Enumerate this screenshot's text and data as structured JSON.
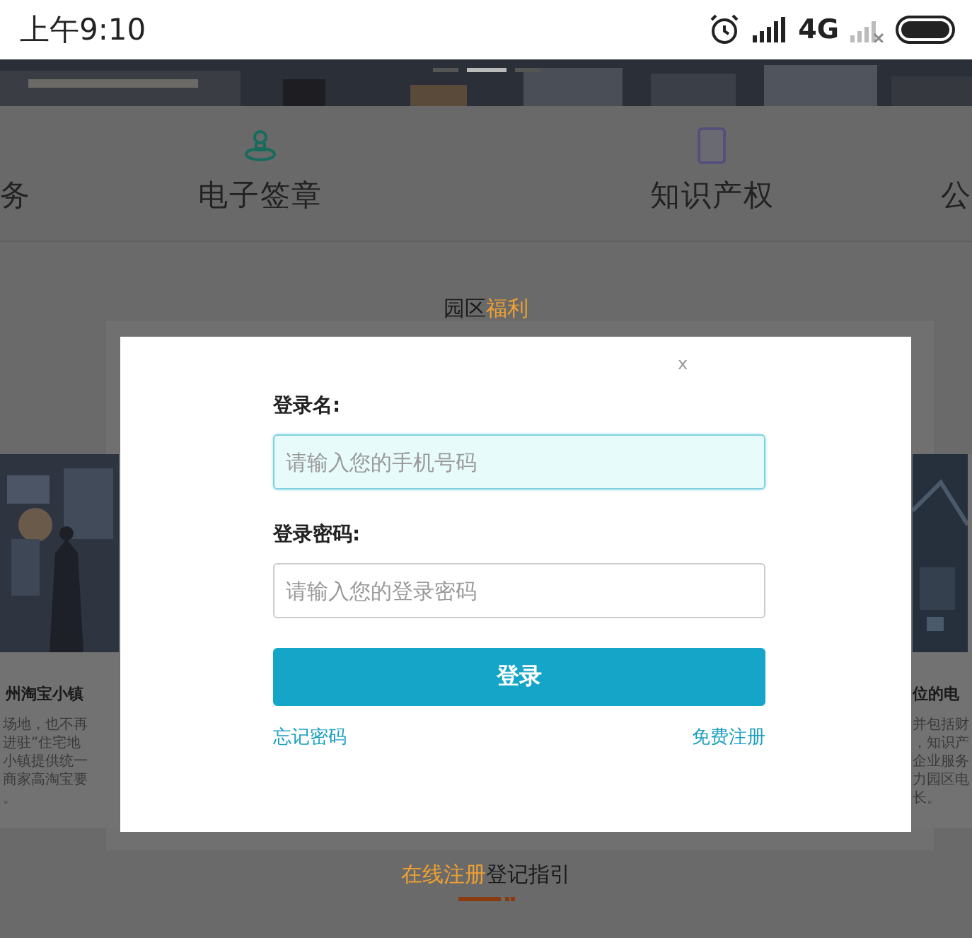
{
  "status_bar": {
    "time": "上午9:10",
    "network": "4G"
  },
  "banner": {
    "slides": [
      {
        "selected": false
      },
      {
        "selected": true
      },
      {
        "selected": false
      }
    ]
  },
  "nav": {
    "items": [
      {
        "label": "务"
      },
      {
        "label": "电子签章"
      },
      {
        "label": "知识产权"
      },
      {
        "label": "公"
      }
    ]
  },
  "section": {
    "title": "园区",
    "title_accent": "福利"
  },
  "cards": [
    {
      "title": "州淘宝小镇",
      "lines": [
        "场地，也不再",
        "进驻”住宅地",
        "小镇提供统一",
        "商家高淘宝要",
        "。"
      ]
    },
    {
      "title": "位的电",
      "lines": [
        "并包括财",
        "，知识产",
        "企业服务",
        "力园区电",
        "长。"
      ]
    }
  ],
  "login": {
    "close": "x",
    "fields": [
      {
        "label": "登录名:",
        "placeholder": "请输入您的手机号码",
        "focused": true
      },
      {
        "label": "登录密码:",
        "placeholder": "请输入您的登录密码",
        "focused": false
      }
    ],
    "submit": "登录",
    "forgot": "忘记密码",
    "register": "免费注册"
  },
  "footer_heading": {
    "accent": "在线注册",
    "title": "登记指引"
  }
}
